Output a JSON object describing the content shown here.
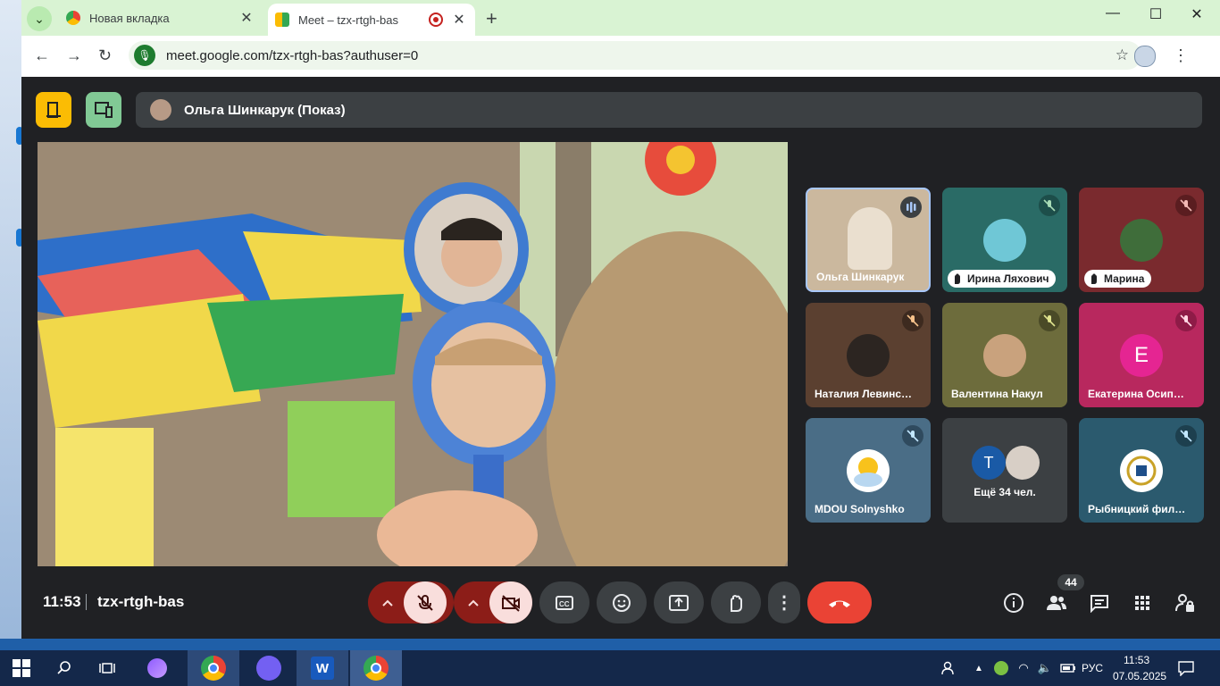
{
  "browser": {
    "tabs": [
      {
        "title": "Новая вкладка"
      },
      {
        "title": "Meet – tzx-rtgh-bas"
      }
    ],
    "url": "meet.google.com/tzx-rtgh-bas?authuser=0"
  },
  "meet": {
    "presenter": {
      "name": "Ольга Шинкарук (Показ)"
    },
    "participants": [
      {
        "name": "Ольга Шинкарук",
        "state": "speaking",
        "bg": "#cbb89e"
      },
      {
        "name": "Ирина Ляхович",
        "state": "hand-raised",
        "bg": "#2a6b66"
      },
      {
        "name": "Марина",
        "state": "hand-raised",
        "bg": "#7a2a2e"
      },
      {
        "name": "Наталия Левинс…",
        "state": "muted",
        "bg": "#5b4030"
      },
      {
        "name": "Валентина Накул",
        "state": "muted",
        "bg": "#6d6c3c"
      },
      {
        "name": "Екатерина Осип…",
        "state": "muted",
        "bg": "#b8285e",
        "initial": "E"
      },
      {
        "name": "MDOU Solnyshko",
        "state": "muted",
        "bg": "#4a6d86"
      },
      {
        "name": "Ещё 34 чел.",
        "state": "more",
        "bg": "#3c4043",
        "initial": "T"
      },
      {
        "name": "Рыбницкий фил…",
        "state": "muted",
        "bg": "#2b5a6e"
      }
    ],
    "meeting_time": "11:53",
    "meeting_code": "tzx-rtgh-bas",
    "participant_count": "44"
  },
  "taskbar": {
    "language": "РУС",
    "time": "11:53",
    "date": "07.05.2025"
  },
  "colors": {
    "accent_yellow": "#fbbc04",
    "accent_green": "#81c995",
    "end_call_red": "#ea4335",
    "mute_pink": "#f9dedc",
    "mute_dark": "#8c1d18"
  }
}
